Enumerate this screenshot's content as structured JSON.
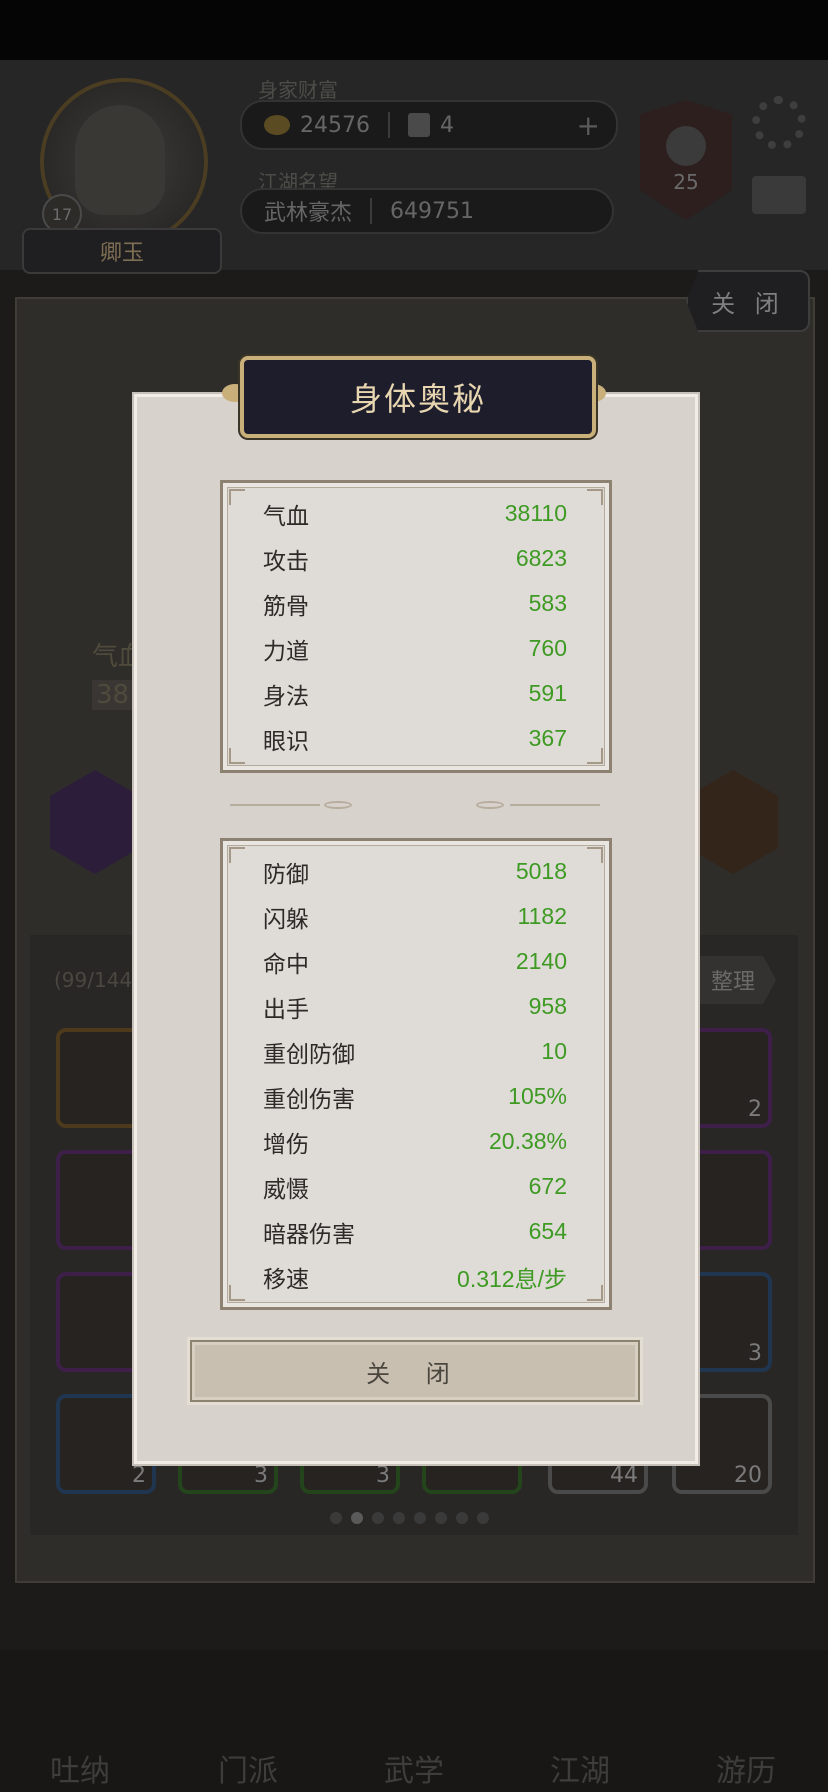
{
  "header": {
    "player_name": "卿玉",
    "level": "17",
    "wealth_label": "身家财富",
    "gold": "24576",
    "tickets": "4",
    "plus": "+",
    "fame_label": "江湖名望",
    "title": "武林豪杰",
    "fame": "649751",
    "sect_level": "25"
  },
  "background": {
    "close_label": "关 闭",
    "bag_capacity": "(99/144",
    "sort_label": "整理",
    "stat_label": "气血",
    "stat_value": "38",
    "slot_counts": [
      "2",
      "3",
      "2",
      "3",
      "3",
      "44",
      "20"
    ],
    "nav": [
      "吐纳",
      "门派",
      "武学",
      "江湖",
      "游历"
    ]
  },
  "modal": {
    "title": "身体奥秘",
    "primary_stats": [
      {
        "label": "气血",
        "value": "38110"
      },
      {
        "label": "攻击",
        "value": "6823"
      },
      {
        "label": "筋骨",
        "value": "583"
      },
      {
        "label": "力道",
        "value": "760"
      },
      {
        "label": "身法",
        "value": "591"
      },
      {
        "label": "眼识",
        "value": "367"
      }
    ],
    "secondary_stats": [
      {
        "label": "防御",
        "value": "5018"
      },
      {
        "label": "闪躲",
        "value": "1182"
      },
      {
        "label": "命中",
        "value": "2140"
      },
      {
        "label": "出手",
        "value": "958"
      },
      {
        "label": "重创防御",
        "value": "10"
      },
      {
        "label": "重创伤害",
        "value": "105%"
      },
      {
        "label": "增伤",
        "value": "20.38%"
      },
      {
        "label": "威慑",
        "value": "672"
      },
      {
        "label": "暗器伤害",
        "value": "654"
      },
      {
        "label": "移速",
        "value": "0.312息/步"
      }
    ],
    "close_label": "关 闭"
  },
  "colors": {
    "stat_value": "#3e9a23",
    "title_text": "#e8d6b0",
    "modal_bg": "#d8d2cc"
  }
}
